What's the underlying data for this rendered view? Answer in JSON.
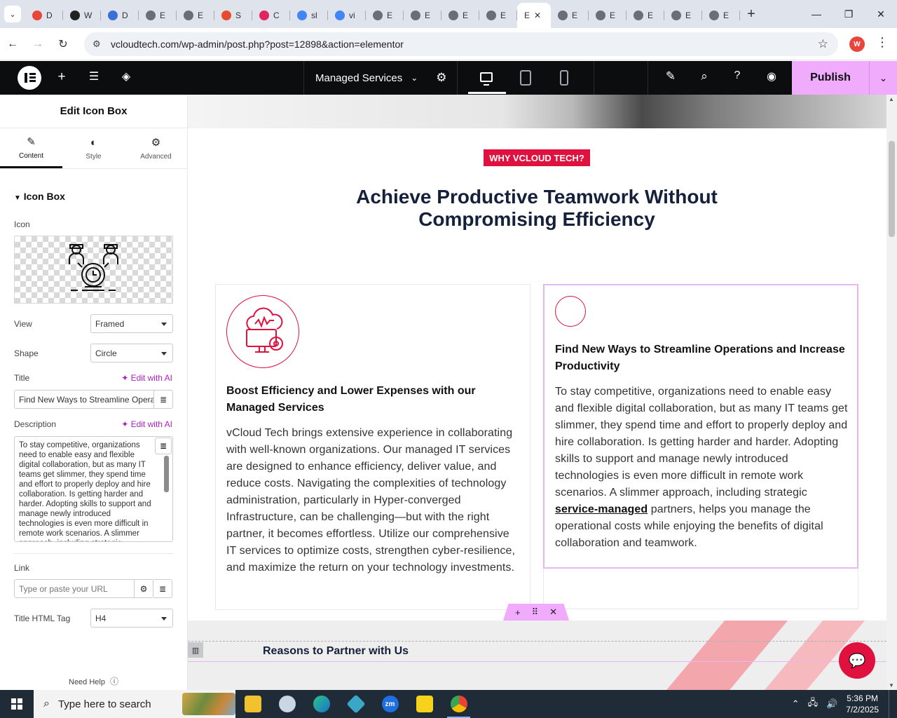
{
  "browser": {
    "tabs": [
      {
        "label": "D",
        "color": "#e8453c"
      },
      {
        "label": "W",
        "color": "#222222"
      },
      {
        "label": "D",
        "color": "#3b6fd8"
      },
      {
        "label": "E",
        "color": "#6b6f75"
      },
      {
        "label": "E",
        "color": "#6b6f75"
      },
      {
        "label": "S",
        "color": "#e84a2f"
      },
      {
        "label": "C",
        "color": "#e0245e"
      },
      {
        "label": "sl",
        "color": "#4285f4"
      },
      {
        "label": "vi",
        "color": "#4285f4"
      },
      {
        "label": "E",
        "color": "#6b6f75"
      },
      {
        "label": "E",
        "color": "#6b6f75"
      },
      {
        "label": "E",
        "color": "#6b6f75"
      },
      {
        "label": "E",
        "color": "#6b6f75"
      }
    ],
    "active_tab": {
      "label": "E"
    },
    "tabs_after": [
      {
        "label": "E",
        "color": "#6b6f75"
      },
      {
        "label": "E",
        "color": "#6b6f75"
      },
      {
        "label": "E",
        "color": "#6b6f75"
      },
      {
        "label": "E",
        "color": "#6b6f75"
      },
      {
        "label": "E",
        "color": "#6b6f75"
      }
    ],
    "url": "vcloudtech.com/wp-admin/post.php?post=12898&action=elementor",
    "profile_initial": "W"
  },
  "editor": {
    "page_name": "Managed Services",
    "publish_label": "Publish",
    "accent": "#f0abfc"
  },
  "panel": {
    "title": "Edit Icon Box",
    "tabs": [
      {
        "label": "Content",
        "icon": "pencil-icon"
      },
      {
        "label": "Style",
        "icon": "half-circle-icon"
      },
      {
        "label": "Advanced",
        "icon": "gear-icon"
      }
    ],
    "section": "Icon Box",
    "icon_label": "Icon",
    "view_label": "View",
    "view_value": "Framed",
    "shape_label": "Shape",
    "shape_value": "Circle",
    "title_label": "Title",
    "edit_ai": "Edit with AI",
    "title_value": "Find New Ways to Streamline Operations and Increase Productivity",
    "description_label": "Description",
    "description_value": "To stay competitive, organizations need to enable easy and flexible digital collaboration, but as many IT teams get slimmer, they spend time and effort to properly deploy and hire collaboration. Is getting harder and harder. Adopting skills to support and manage newly introduced technologies is even more difficult in remote work scenarios. A slimmer approach, including strategic",
    "link_label": "Link",
    "link_placeholder": "Type or paste your URL",
    "html_tag_label": "Title HTML Tag",
    "html_tag_value": "H4",
    "need_help": "Need Help"
  },
  "canvas": {
    "badge": "WHY VCLOUD TECH?",
    "headline": "Achieve Productive Teamwork Without Compromising Efficiency",
    "card1": {
      "title": "Boost Efficiency and Lower Expenses with our Managed Services",
      "description": "vCloud Tech brings extensive experience in collaborating with well-known organizations. Our managed IT services are designed to enhance efficiency, deliver value, and reduce costs. Navigating the complexities of technology administration, particularly in Hyper-converged Infrastructure, can be challenging—but with the right partner, it becomes effortless. Utilize our comprehensive IT services to optimize costs, strengthen cyber-resilience, and maximize the return on your technology investments."
    },
    "card2": {
      "title": "Find New Ways to Streamline Operations and Increase Productivity",
      "description_before": "To stay competitive, organizations need to enable easy and flexible digital collaboration, but as many IT teams get slimmer, they spend time and effort to properly deploy and hire collaboration. Is getting harder and harder. Adopting skills to support and manage newly introduced technologies is even more difficult in remote work scenarios. A slimmer approach, including strategic ",
      "link_text": "service-managed",
      "description_after": " partners, helps you manage the operational costs while enjoying the benefits of digital collaboration and teamwork."
    },
    "next_section_title": "Reasons to Partner with Us",
    "brand_red": "#e0103f",
    "heading_color": "#15203a"
  },
  "taskbar": {
    "search_placeholder": "Type here to search",
    "time": "5:36 PM",
    "date": "7/2/2025"
  }
}
